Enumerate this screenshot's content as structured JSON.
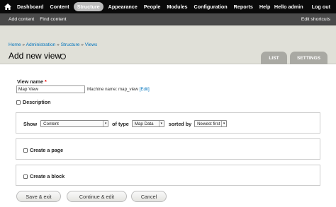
{
  "toolbar": {
    "home_icon": "home-icon",
    "menu": [
      {
        "label": "Dashboard",
        "active": false
      },
      {
        "label": "Content",
        "active": false
      },
      {
        "label": "Structure",
        "active": true
      },
      {
        "label": "Appearance",
        "active": false
      },
      {
        "label": "People",
        "active": false
      },
      {
        "label": "Modules",
        "active": false
      },
      {
        "label": "Configuration",
        "active": false
      },
      {
        "label": "Reports",
        "active": false
      },
      {
        "label": "Help",
        "active": false
      }
    ],
    "hello_prefix": "Hello ",
    "username": "admin",
    "logout": "Log out"
  },
  "shortcuts": {
    "add_content": "Add content",
    "find_content": "Find content",
    "edit_shortcuts": "Edit shortcuts"
  },
  "breadcrumb": [
    "Home",
    "Administration",
    "Structure",
    "Views"
  ],
  "breadcrumb_sep": " » ",
  "page_title": "Add new view",
  "tabs": {
    "list": "LIST",
    "settings": "SETTINGS"
  },
  "form": {
    "view_name_label": "View name",
    "required_marker": "*",
    "view_name_value": "Map View",
    "machine_name_prefix": "Machine name: map_view",
    "machine_edit": "[Edit]",
    "description_label": "Description",
    "show_label": "Show",
    "show_value": "Content",
    "of_type_label": "of type",
    "type_value": "Map Data",
    "sorted_by_label": "sorted by",
    "sort_value": "Newest first",
    "create_page_label": "Create a page",
    "create_block_label": "Create a block"
  },
  "buttons": {
    "save": "Save & exit",
    "continue": "Continue & edit",
    "cancel": "Cancel"
  },
  "colors": {
    "toolbar_bg": "#0a0a0a",
    "shortcut_bg": "#4a4a4a",
    "header_bg": "#e0e0d8",
    "link": "#0074bd",
    "tab_bg": "#a9a9a3"
  }
}
